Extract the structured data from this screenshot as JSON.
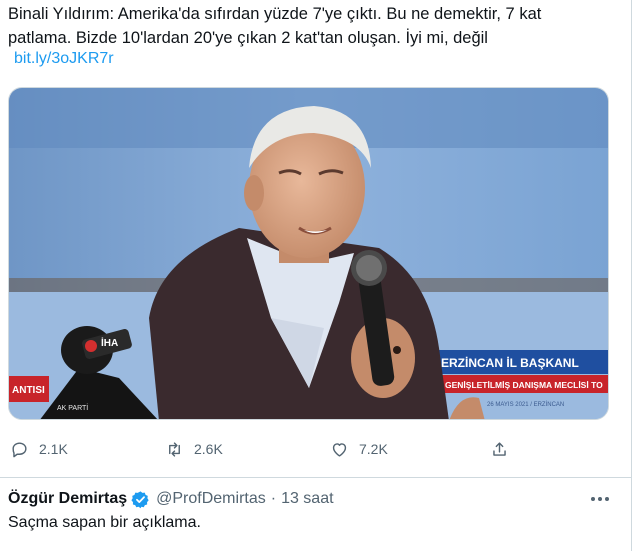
{
  "tweet": {
    "lines": [
      "Binali Yıldırım: Amerika'da sıfırdan yüzde 7'ye çıktı. Bu ne demektir, 7 kat",
      "patlama. Bizde 10'lardan 20'ye çıkan 2 kat'tan oluşan. İyi mi, değil"
    ],
    "link": "bit.ly/3oJKR7r"
  },
  "media": {
    "banner_right_title": "ERZİNCAN İL BAŞKANL",
    "banner_right_sub": "GENİŞLETİLMİŞ DANIŞMA MECLİSİ TO",
    "banner_right_small": "26 MAYIS 2021 / ERZİNCAN",
    "banner_left": "ANTISI",
    "mic_brand": "İHA",
    "party_mark": "AK PARTİ"
  },
  "actions": {
    "replies": "2.1K",
    "retweets": "2.6K",
    "likes": "7.2K"
  },
  "reply": {
    "name": "Özgür Demirtaş",
    "handle": "@ProfDemirtas",
    "separator": "·",
    "time": "13 saat",
    "text": "Saçma sapan bir açıklama."
  },
  "colors": {
    "link": "#1d9bf0",
    "muted": "#536471",
    "verified": "#1d9bf0",
    "banner": "#1f4fa0"
  }
}
